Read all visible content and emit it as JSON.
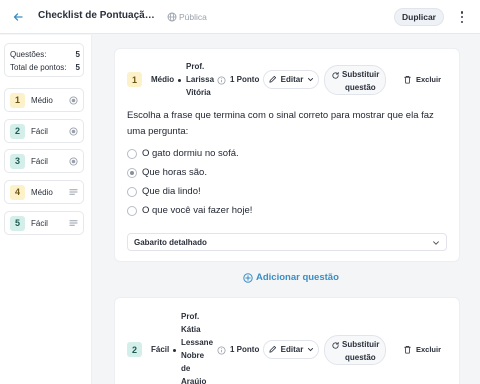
{
  "header": {
    "title": "Checklist de Pontuação: Su...",
    "visibility": "Pública",
    "duplicate_label": "Duplicar"
  },
  "sidebar": {
    "stats": {
      "questions_label": "Questões:",
      "questions_value": "5",
      "points_label": "Total de pontos:",
      "points_value": "5"
    },
    "items": [
      {
        "num": "1",
        "difficulty": "Médio",
        "icon": "radio-icon"
      },
      {
        "num": "2",
        "difficulty": "Fácil",
        "icon": "radio-icon"
      },
      {
        "num": "3",
        "difficulty": "Fácil",
        "icon": "radio-icon"
      },
      {
        "num": "4",
        "difficulty": "Médio",
        "icon": "lines-icon"
      },
      {
        "num": "5",
        "difficulty": "Fácil",
        "icon": "lines-icon"
      }
    ]
  },
  "questions": [
    {
      "num": "1",
      "difficulty": "Médio",
      "author_lines": [
        "Prof.",
        "Larissa",
        "Vitória"
      ],
      "points": "1 Ponto",
      "edit_label": "Editar",
      "substitute_lines": [
        "Substituir",
        "questão"
      ],
      "delete_label": "Excluir",
      "text": "Escolha a frase que termina com o sinal correto para mostrar que ela faz uma pergunta:",
      "options": [
        {
          "text": "O gato dormiu no sofá.",
          "checked": false
        },
        {
          "text": "Que horas são.",
          "checked": true
        },
        {
          "text": "Que dia lindo!",
          "checked": false
        },
        {
          "text": "O que você vai fazer hoje!",
          "checked": false
        }
      ],
      "gabarito_label": "Gabarito detalhado"
    },
    {
      "num": "2",
      "difficulty": "Fácil",
      "author_lines": [
        "Prof.",
        "Kátia",
        "Lessane",
        "Nobre",
        "de",
        "Araújo"
      ],
      "points": "1 Ponto",
      "edit_label": "Editar",
      "substitute_lines": [
        "Substituir",
        "questão"
      ],
      "delete_label": "Excluir"
    }
  ],
  "add_question_label": "Adicionar questão",
  "colors": {
    "accent": "#3a8ec4",
    "medio_bg": "#fdf1c9",
    "facil_bg": "#d4eee9"
  }
}
